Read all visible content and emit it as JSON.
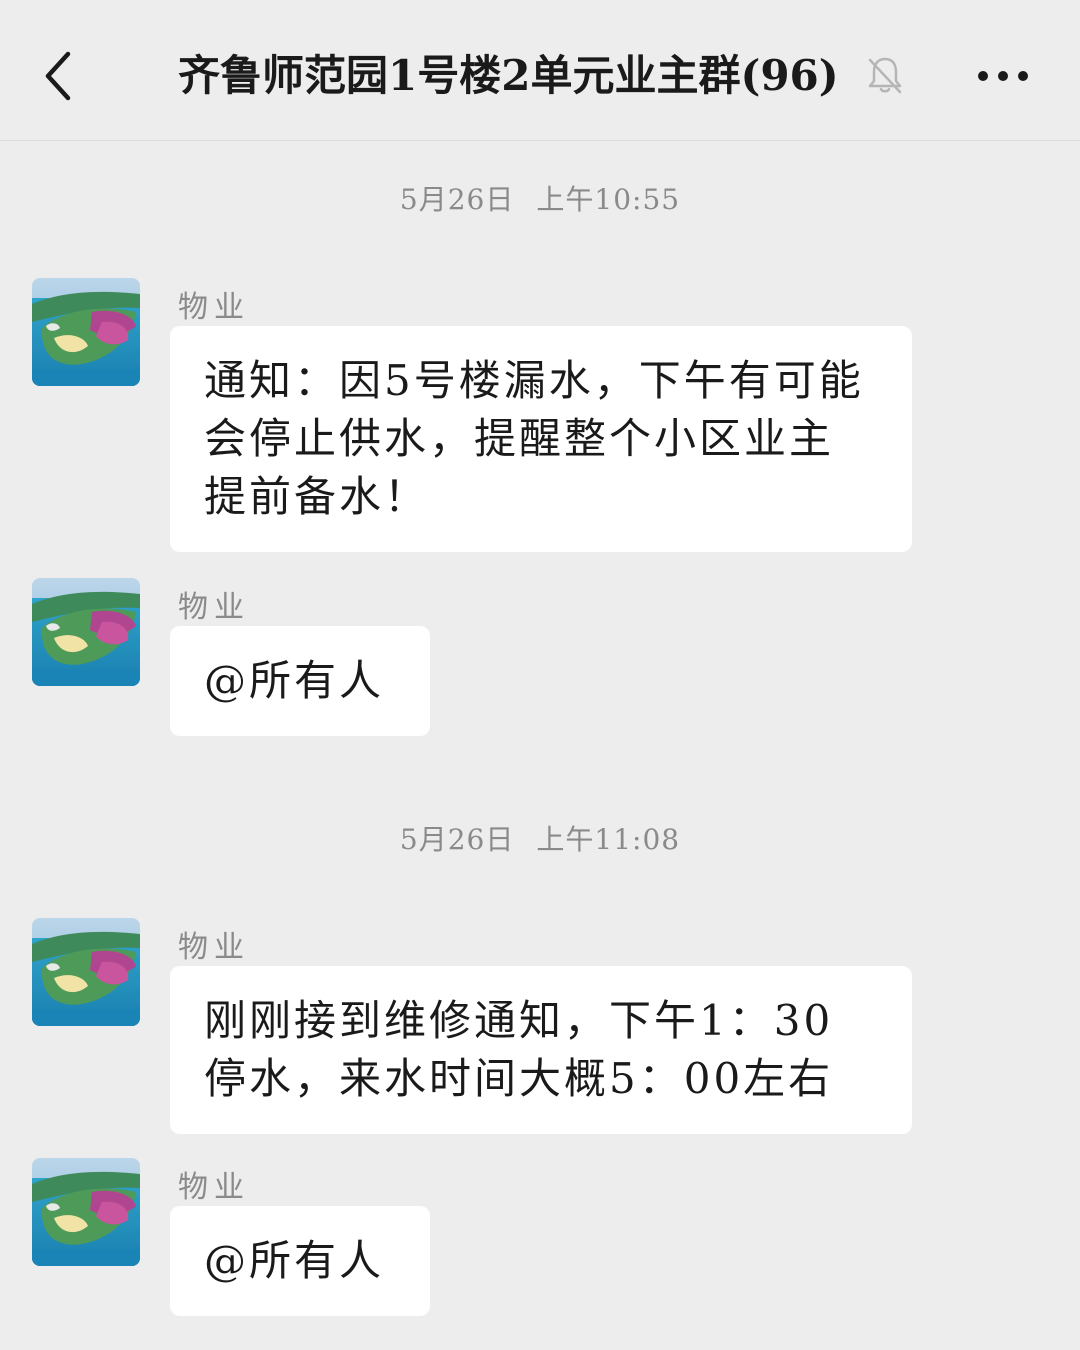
{
  "header": {
    "title": "齐鲁师范园1号楼2单元业主群(96)",
    "back_icon": "chevron-left-icon",
    "mute_icon": "bell-off-icon",
    "more_icon": "more-dots-icon"
  },
  "timestamps": [
    {
      "date": "5月26日",
      "time": "上午10:55"
    },
    {
      "date": "5月26日",
      "time": "上午11:08"
    }
  ],
  "messages": [
    {
      "sender": "物业",
      "text": "通知：因5号楼漏水，下午有可能会停止供水，提醒整个小区业主提前备水！"
    },
    {
      "sender": "物业",
      "text": "@所有人"
    },
    {
      "sender": "物业",
      "text": "刚刚接到维修通知，下午1：30停水，来水时间大概5：00左右"
    },
    {
      "sender": "物业",
      "text": "@所有人"
    }
  ],
  "colors": {
    "background": "#ededed",
    "bubble": "#ffffff",
    "text": "#1a1a1a",
    "muted_text": "#8a8a8a"
  }
}
